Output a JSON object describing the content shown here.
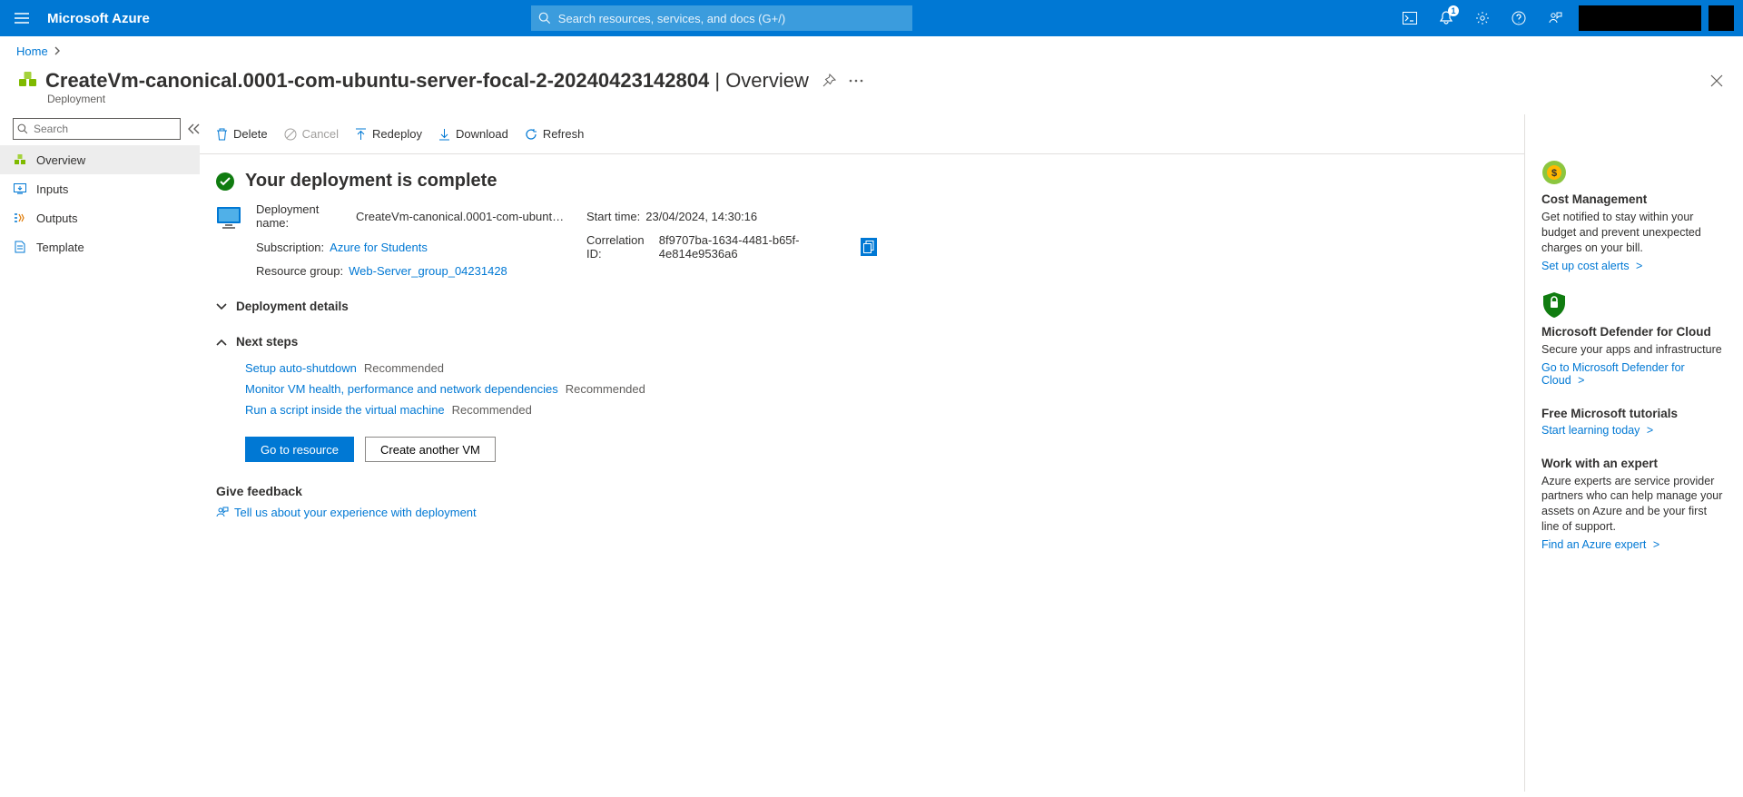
{
  "topbar": {
    "brand": "Microsoft Azure",
    "search_placeholder": "Search resources, services, and docs (G+/)",
    "notification_count": "1"
  },
  "breadcrumb": {
    "home": "Home"
  },
  "title": {
    "name": "CreateVm-canonical.0001-com-ubuntu-server-focal-2-20240423142804",
    "section": "Overview",
    "subtitle": "Deployment"
  },
  "sidebar": {
    "search_placeholder": "Search",
    "items": [
      {
        "label": "Overview",
        "icon": "overview",
        "active": true
      },
      {
        "label": "Inputs",
        "icon": "inputs",
        "active": false
      },
      {
        "label": "Outputs",
        "icon": "outputs",
        "active": false
      },
      {
        "label": "Template",
        "icon": "template",
        "active": false
      }
    ]
  },
  "toolbar": {
    "delete": "Delete",
    "cancel": "Cancel",
    "redeploy": "Redeploy",
    "download": "Download",
    "refresh": "Refresh"
  },
  "status_heading": "Your deployment is complete",
  "deployment": {
    "name_label": "Deployment name:",
    "name_value": "CreateVm-canonical.0001-com-ubuntu-server-f...",
    "subscription_label": "Subscription:",
    "subscription_value": "Azure for Students",
    "rg_label": "Resource group:",
    "rg_value": "Web-Server_group_04231428",
    "start_label": "Start time:",
    "start_value": "23/04/2024, 14:30:16",
    "corr_label": "Correlation ID:",
    "corr_value": "8f9707ba-1634-4481-b65f-4e814e9536a6"
  },
  "sections": {
    "details_header": "Deployment details",
    "next_header": "Next steps"
  },
  "next_steps": [
    {
      "link": "Setup auto-shutdown",
      "rec": "Recommended"
    },
    {
      "link": "Monitor VM health, performance and network dependencies",
      "rec": "Recommended"
    },
    {
      "link": "Run a script inside the virtual machine",
      "rec": "Recommended"
    }
  ],
  "buttons": {
    "go": "Go to resource",
    "another": "Create another VM"
  },
  "feedback": {
    "heading": "Give feedback",
    "link": "Tell us about your experience with deployment"
  },
  "right": [
    {
      "icon": "cost",
      "title": "Cost Management",
      "desc": "Get notified to stay within your budget and prevent unexpected charges on your bill.",
      "link": "Set up cost alerts"
    },
    {
      "icon": "defender",
      "title": "Microsoft Defender for Cloud",
      "desc": "Secure your apps and infrastructure",
      "link": "Go to Microsoft Defender for Cloud"
    },
    {
      "icon": "",
      "title": "Free Microsoft tutorials",
      "desc": "",
      "link": "Start learning today"
    },
    {
      "icon": "",
      "title": "Work with an expert",
      "desc": "Azure experts are service provider partners who can help manage your assets on Azure and be your first line of support.",
      "link": "Find an Azure expert"
    }
  ]
}
